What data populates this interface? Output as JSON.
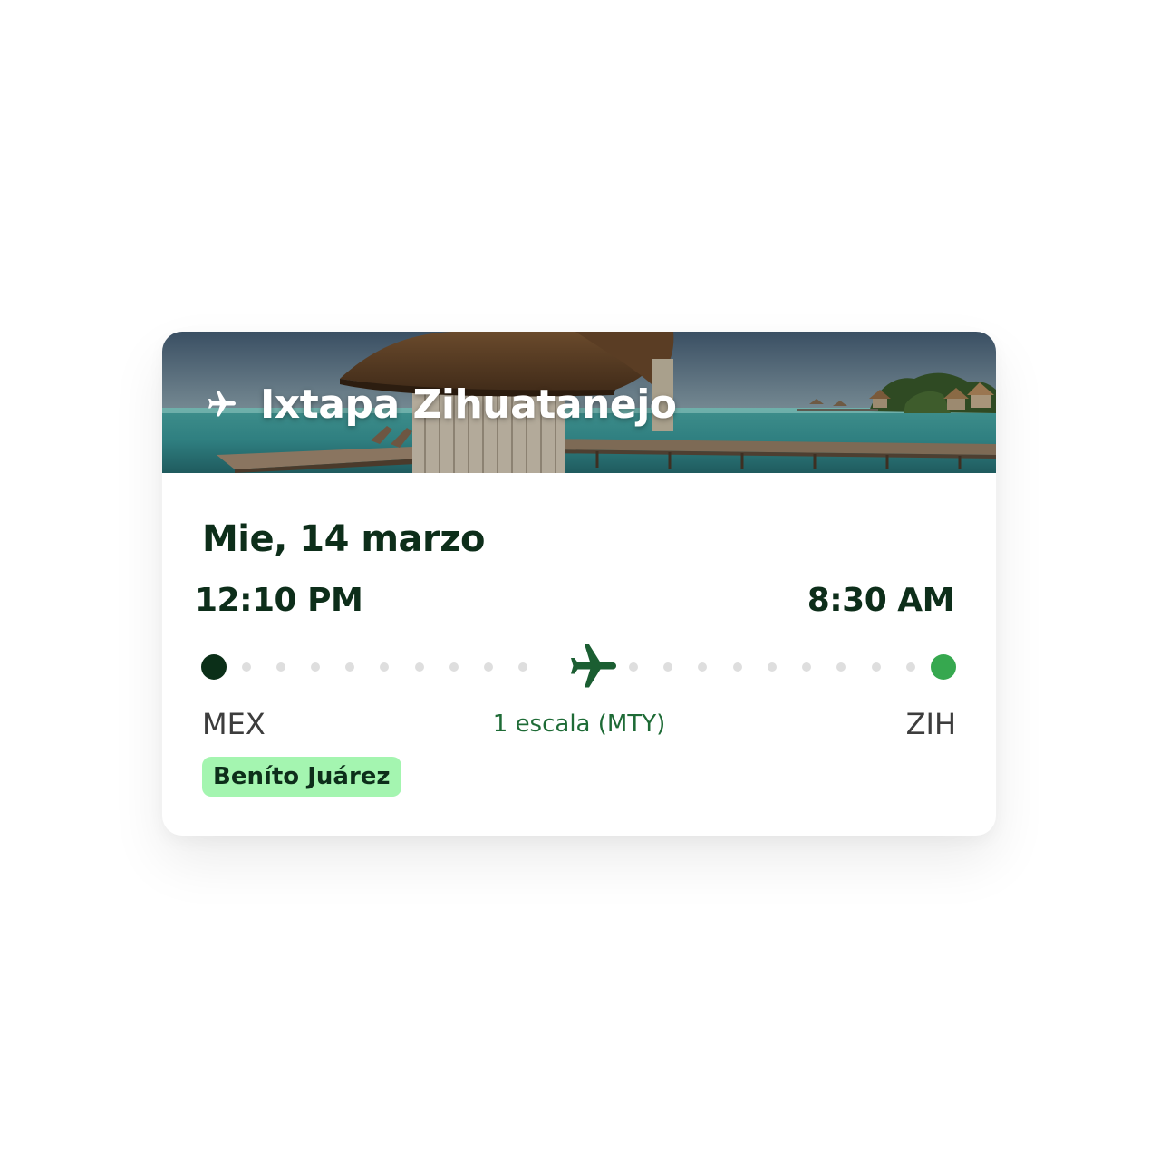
{
  "header": {
    "destination_title": "Ixtapa Zihuatanejo",
    "icon": "airplane-icon"
  },
  "flight": {
    "date": "Mie, 14 marzo",
    "departure_time": "12:10 PM",
    "arrival_time": "8:30 AM",
    "origin_code": "MEX",
    "destination_code": "ZIH",
    "stops_text": "1 escala (MTY)",
    "origin_airport_badge": "Beníto Juárez"
  },
  "colors": {
    "dark_green": "#0d2e1a",
    "accent_green": "#36a84f",
    "stop_text_green": "#1e6b36",
    "badge_bg": "#a4f5b0"
  }
}
